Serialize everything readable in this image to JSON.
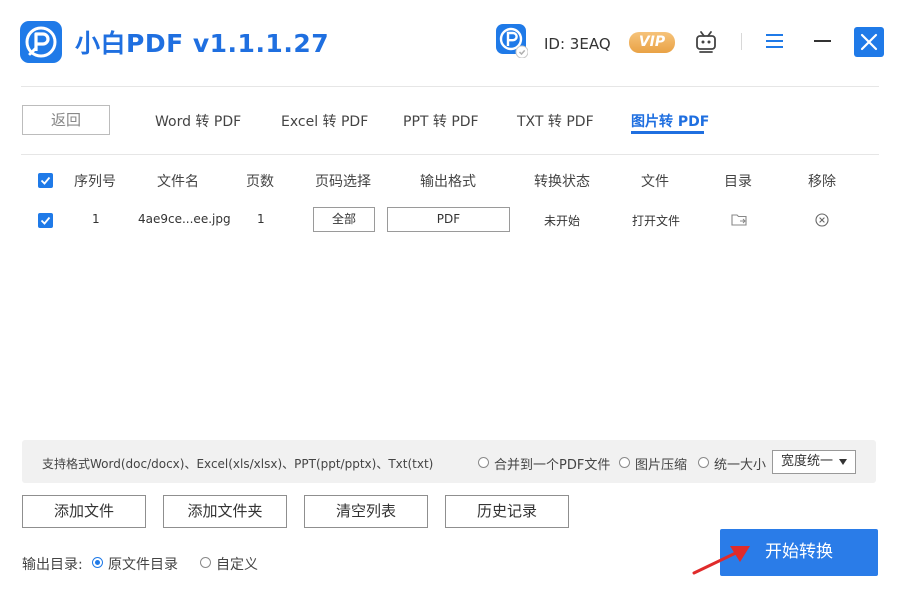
{
  "app": {
    "title": "小白PDF v1.1.1.27",
    "user_id": "ID: 3EAQ",
    "vip": "VIP"
  },
  "nav": {
    "back_label": "返回",
    "tabs": [
      {
        "label": "Word 转 PDF"
      },
      {
        "label": "Excel 转 PDF"
      },
      {
        "label": "PPT 转 PDF"
      },
      {
        "label": "TXT 转 PDF"
      },
      {
        "label": "图片转 PDF"
      }
    ],
    "active_tab": "图片转 PDF"
  },
  "table": {
    "headers": [
      "序列号",
      "文件名",
      "页数",
      "页码选择",
      "输出格式",
      "转换状态",
      "文件",
      "目录",
      "移除"
    ],
    "rows": [
      {
        "checked": true,
        "index": "1",
        "filename": "4ae9ce...ee.jpg",
        "pages": "1",
        "page_select": "全部",
        "output_format": "PDF",
        "status": "未开始",
        "open_file": "打开文件"
      }
    ]
  },
  "options": {
    "supported_formats": "支持格式Word(doc/docx)、Excel(xls/xlsx)、PPT(ppt/pptx)、Txt(txt)",
    "merge_label": "合并到一个PDF文件",
    "compress_label": "图片压缩",
    "unify_size_label": "统一大小",
    "size_select": "宽度统一"
  },
  "actions": {
    "add_file": "添加文件",
    "add_folder": "添加文件夹",
    "clear_list": "清空列表",
    "history": "历史记录",
    "start": "开始转换"
  },
  "output": {
    "label": "输出目录:",
    "original_dir": "原文件目录",
    "custom": "自定义",
    "selected": "原文件目录"
  },
  "colors": {
    "accent": "#1f7ae8",
    "vip": "#e9a245",
    "annotation_arrow": "#e02b2b"
  }
}
